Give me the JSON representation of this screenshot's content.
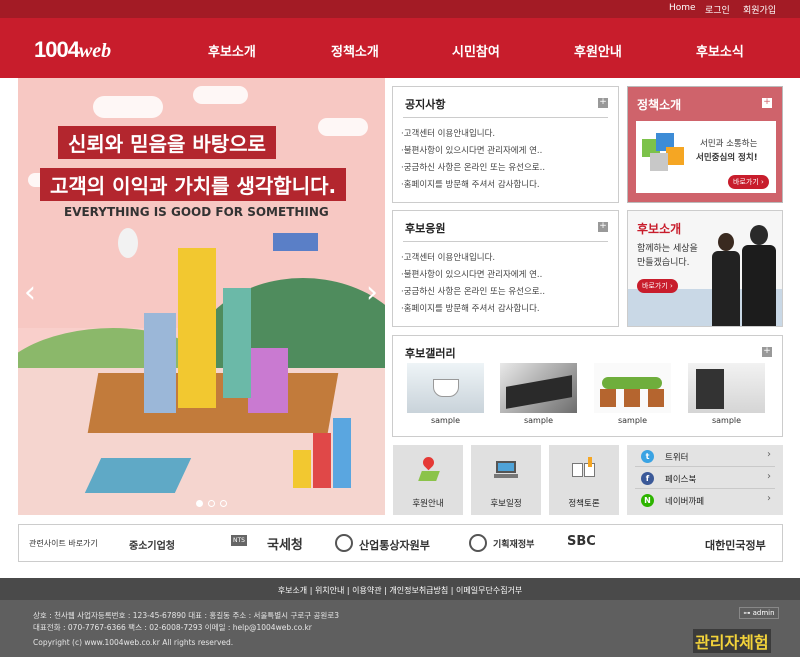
{
  "topbar": {
    "home": "Home",
    "login": "로그인",
    "join": "회원가입"
  },
  "logo": {
    "num": "1004",
    "web": "web"
  },
  "nav": [
    "후보소개",
    "정책소개",
    "시민참여",
    "후원안내",
    "후보소식"
  ],
  "hero": {
    "headline1": "신뢰와 믿음을 바탕으로",
    "headline2": "고객의 이익과 가치를 생각합니다.",
    "slogan": "EVERYTHING IS GOOD FOR SOMETHING",
    "prev": "‹",
    "next": "›"
  },
  "notice": {
    "title": "공지사항",
    "items": [
      "·고객센터 이용안내입니다.",
      "·불편사항이 있으시다면 관리자에게 연..",
      "·궁금하신 사항은 온라인 또는 유선으로..",
      "·홈페이지를 방문해 주셔서 감사합니다."
    ]
  },
  "support": {
    "title": "후보응원",
    "items": [
      "·고객센터 이용안내입니다.",
      "·불편사항이 있으시다면 관리자에게 연..",
      "·궁금하신 사항은 온라인 또는 유선으로..",
      "·홈페이지를 방문해 주셔서 감사합니다."
    ]
  },
  "policy": {
    "title": "정책소개",
    "line1": "서민과 소통하는",
    "line2": "서민중심의 정치!",
    "btn": "바로가기 ›"
  },
  "promo": {
    "title": "후보소개",
    "line1": "함께하는 세상을",
    "line2": "만들겠습니다.",
    "btn": "바로가기 ›"
  },
  "gallery": {
    "title": "후보갤러리",
    "captions": [
      "sample",
      "sample",
      "sample",
      "sample"
    ]
  },
  "quick": [
    "후원안내",
    "후보일정",
    "정책토론"
  ],
  "sns": [
    {
      "icon": "t",
      "label": "트위터",
      "color": "#3aa3e3"
    },
    {
      "icon": "f",
      "label": "페이스북",
      "color": "#3b5998"
    },
    {
      "icon": "N",
      "label": "네이버까페",
      "color": "#2db400"
    }
  ],
  "links": {
    "title": "관련사이트 바로가기",
    "sites": [
      "중소기업청",
      "국세청",
      "산업통상자원부",
      "기획재정부",
      "SBC",
      "대한민국정부"
    ],
    "nts_badge": "NTS"
  },
  "footer": {
    "menu": "후보소개 | 위치안내 | 이용약관 | 개인정보취급방침 | 이메일무단수집거부",
    "line1": "상호 : 천사웹  사업자등록번호 : 123-45-67890  대표 : 홍길동  주소 : 서울특별시 구로구 공원로3",
    "line2": "대표전화 : 070-7767-6366  팩스 : 02-6008-7293  이메일 : help@1004web.co.kr",
    "copyright": "Copyright (c) www.1004web.co.kr All rights reserved.",
    "admin": "⊶ admin",
    "trial": "관리자체험"
  }
}
